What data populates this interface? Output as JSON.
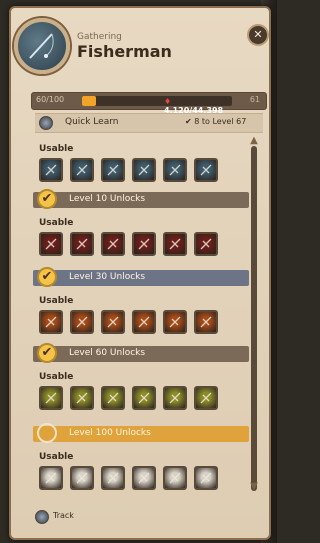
{
  "header": {
    "subtitle": "Gathering",
    "title": "Fisherman",
    "close_label": "✕"
  },
  "progress": {
    "level_text": "60/100",
    "xp_text": "4,120/44,398",
    "right_text": "61",
    "fraction": 0.093
  },
  "quick_learn": {
    "label": "Quick Learn",
    "target_text": "8 to Level 67"
  },
  "sections": [
    {
      "usable_label": "Usable",
      "color": "#3e5b6b",
      "bar_label": "",
      "bar_color": ""
    },
    {
      "usable_label": "Usable",
      "color": "#6b1e1a",
      "bar_label": "Level 10 Unlocks",
      "bar_color": "#7c6a58"
    },
    {
      "usable_label": "Usable",
      "color": "#a34a19",
      "bar_label": "Level 30 Unlocks",
      "bar_color": "#6d7486"
    },
    {
      "usable_label": "Usable",
      "color": "#8b8b2a",
      "bar_label": "Level 60 Unlocks",
      "bar_color": "#7c6a58"
    },
    {
      "usable_label": "Usable",
      "color": "#d8d2c6",
      "bar_label": "Level 100 Unlocks",
      "bar_color": "#e0a23a"
    }
  ],
  "footer": {
    "track_label": "Track"
  },
  "colors": {
    "panel": "#e3d3bb",
    "accent_gold": "#f1a32a",
    "text_dark": "#3b2c1e"
  }
}
